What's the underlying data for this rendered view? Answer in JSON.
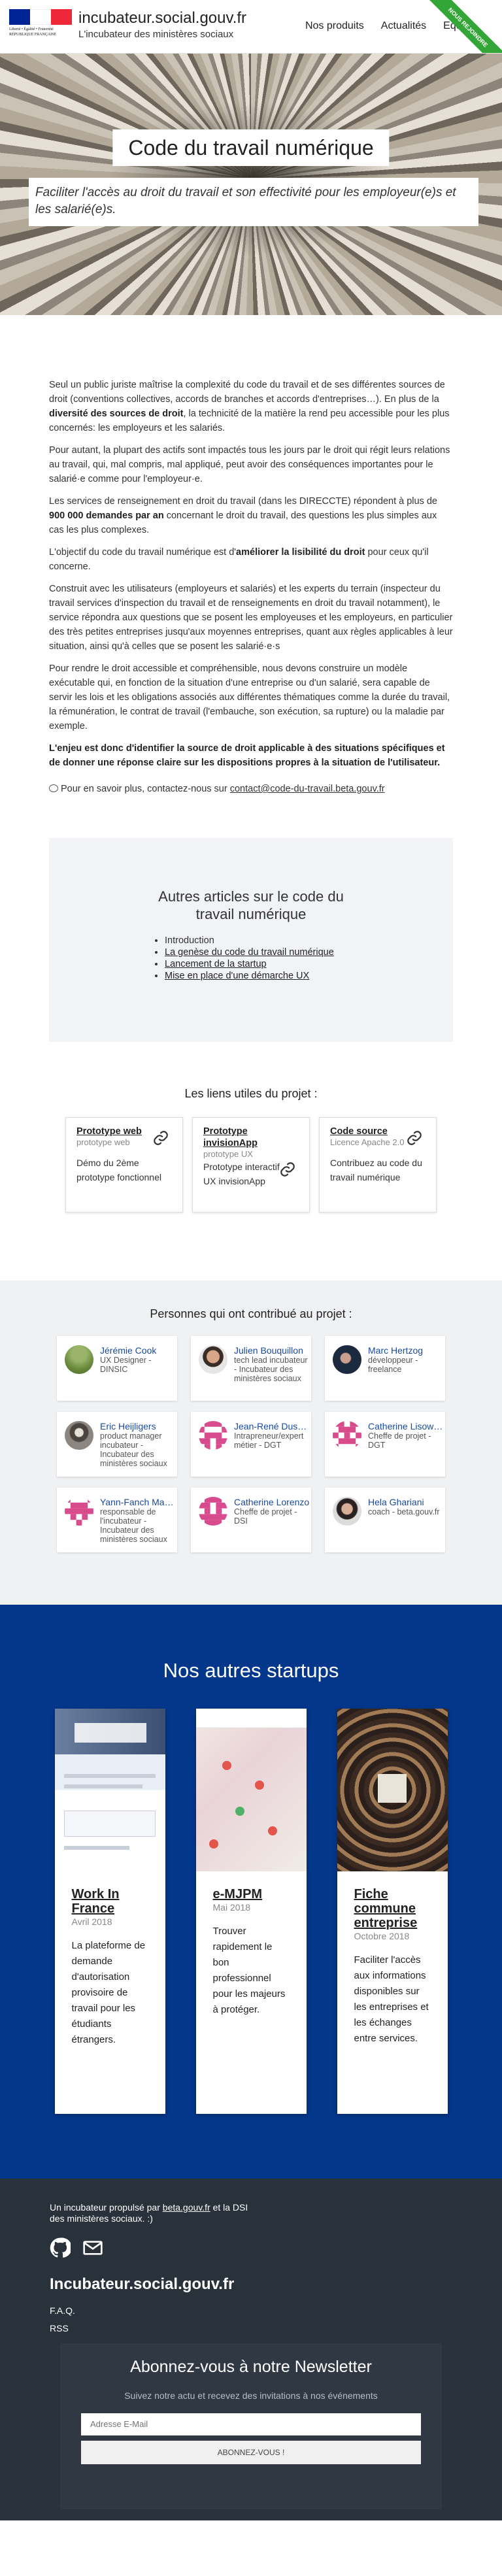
{
  "header": {
    "logo_text": "Liberté • Égalité • Fraternité RÉPUBLIQUE FRANÇAISE",
    "title": "incubateur.social.gouv.fr",
    "subtitle": "L'incubateur des ministères sociaux",
    "nav": [
      "Nos produits",
      "Actualités",
      "Equipe"
    ],
    "ribbon": "Nous rejoindre",
    "flag_colors": [
      "#002395",
      "#ffffff",
      "#ed2939"
    ]
  },
  "hero": {
    "title": "Code du travail numérique",
    "description": "Faciliter l'accès au droit du travail et son effectivité pour les employeur(e)s et les salarié(e)s."
  },
  "article": {
    "p1a": "Seul un public juriste maîtrise la complexité du code du travail et de ses différentes sources de droit (conventions collectives, accords de branches et accords d'entreprises…). En plus de la ",
    "p1b": "diversité des sources de droit",
    "p1c": ", la technicité de la matière la rend peu accessible pour les plus concernés: les employeurs et les salariés.",
    "p2": "Pour autant, la plupart des actifs sont impactés tous les jours par le droit qui régit leurs relations au travail, qui, mal compris, mal appliqué, peut avoir des conséquences importantes pour le salarié·e comme pour l'employeur·e.",
    "p3a": "Les services de renseignement en droit du travail (dans les DIRECCTE) répondent à plus de ",
    "p3b": "900 000 demandes par an",
    "p3c": " concernant le droit du travail, des questions les plus simples aux cas les plus complexes.",
    "p4a": "L'objectif du code du travail numérique est d'",
    "p4b": "améliorer la lisibilité du droit",
    "p4c": " pour ceux qu'il concerne.",
    "p5": "Construit avec les utilisateurs (employeurs et salariés) et les experts du terrain (inspecteur du travail services d'inspection du travail et de renseignements en droit du travail notamment), le service répondra aux questions que se posent les employeuses et les employeurs, en particulier des très petites entreprises jusqu'aux moyennes entreprises, quant aux règles applicables à leur situation, ainsi qu'à celles que se posent les salarié·e·s",
    "p6": "Pour rendre le droit accessible et compréhensible, nous devons construire un modèle exécutable qui, en fonction de la situation d'une entreprise ou d'un salarié, sera capable de servir les lois et les obligations associés aux différentes thématiques comme la durée du travail, la rémunération, le contrat de travail (l'embauche, son exécution, sa rupture) ou la maladie par exemple.",
    "p7": "L'enjeu est donc d'identifier la source de droit applicable à des situations spécifiques et de donner une réponse claire sur les dispositions propres à la situation de l'utilisateur.",
    "contact_prefix": "Pour en savoir plus, contactez-nous sur ",
    "contact_email": "contact@code-du-travail.beta.gouv.fr"
  },
  "other_articles": {
    "title": "Autres articles sur le code du travail numérique",
    "items": [
      "Introduction",
      "La genèse du code du travail numérique",
      "Lancement de la startup",
      "Mise en place d'une démarche UX"
    ]
  },
  "links": {
    "title": "Les liens utiles du projet :",
    "cards": [
      {
        "title": "Prototype web",
        "sub": "prototype web",
        "desc": "Démo du 2ème prototype fonctionnel"
      },
      {
        "title": "Prototype invisionApp",
        "sub": "prototype UX",
        "desc": "Prototype interactif UX invisionApp"
      },
      {
        "title": "Code source",
        "sub": "Licence Apache 2.0",
        "desc": "Contribuez au code du travail numérique"
      }
    ]
  },
  "contributors": {
    "title": "Personnes qui ont contribué au projet :",
    "people": [
      {
        "name": "Jérémie Cook",
        "role": "UX Designer - DINSIC"
      },
      {
        "name": "Julien Bouquillon",
        "role": "tech lead incubateur - Incubateur des ministères sociaux"
      },
      {
        "name": "Marc Hertzog",
        "role": "développeur - freelance"
      },
      {
        "name": "Eric Heijligers",
        "role": "product manager incubateur - Incubateur des ministères sociaux"
      },
      {
        "name": "Jean-René Duscher",
        "role": "Intrapreneur/expert métier - DGT"
      },
      {
        "name": "Catherine Lisowski",
        "role": "Cheffe de projet - DGT"
      },
      {
        "name": "Yann-Fanch Maneau",
        "role": "responsable de l'incubateur - Incubateur des ministères sociaux"
      },
      {
        "name": "Catherine Lorenzo",
        "role": "Cheffe de projet - DSI"
      },
      {
        "name": "Hela Ghariani",
        "role": "coach - beta.gouv.fr"
      }
    ]
  },
  "startups": {
    "title": "Nos autres startups",
    "items": [
      {
        "title": "Work In France",
        "date": "Avril 2018",
        "desc": "La plateforme de demande d'autorisation provisoire de travail pour les étudiants étrangers."
      },
      {
        "title": "e-MJPM",
        "date": "Mai 2018",
        "desc": "Trouver rapidement le bon professionnel pour les majeurs à protéger."
      },
      {
        "title": "Fiche commune entreprise",
        "date": "Octobre 2018",
        "desc": "Faciliter l'accès aux informations disponibles sur les entreprises et les échanges entre services."
      }
    ]
  },
  "footer": {
    "line_prefix": "Un incubateur propulsé par ",
    "line_link1": "beta.gouv.fr",
    "line_mid": " et la DSI des ministères sociaux. :)",
    "brand": "Incubateur.social.gouv.fr",
    "links": [
      "F.A.Q.",
      "RSS"
    ]
  },
  "newsletter": {
    "title": "Abonnez-vous à notre Newsletter",
    "subtitle": "Suivez notre actu et recevez des invitations à nos événements",
    "placeholder": "Adresse E-Mail",
    "button": "ABONNEZ-VOUS !"
  }
}
